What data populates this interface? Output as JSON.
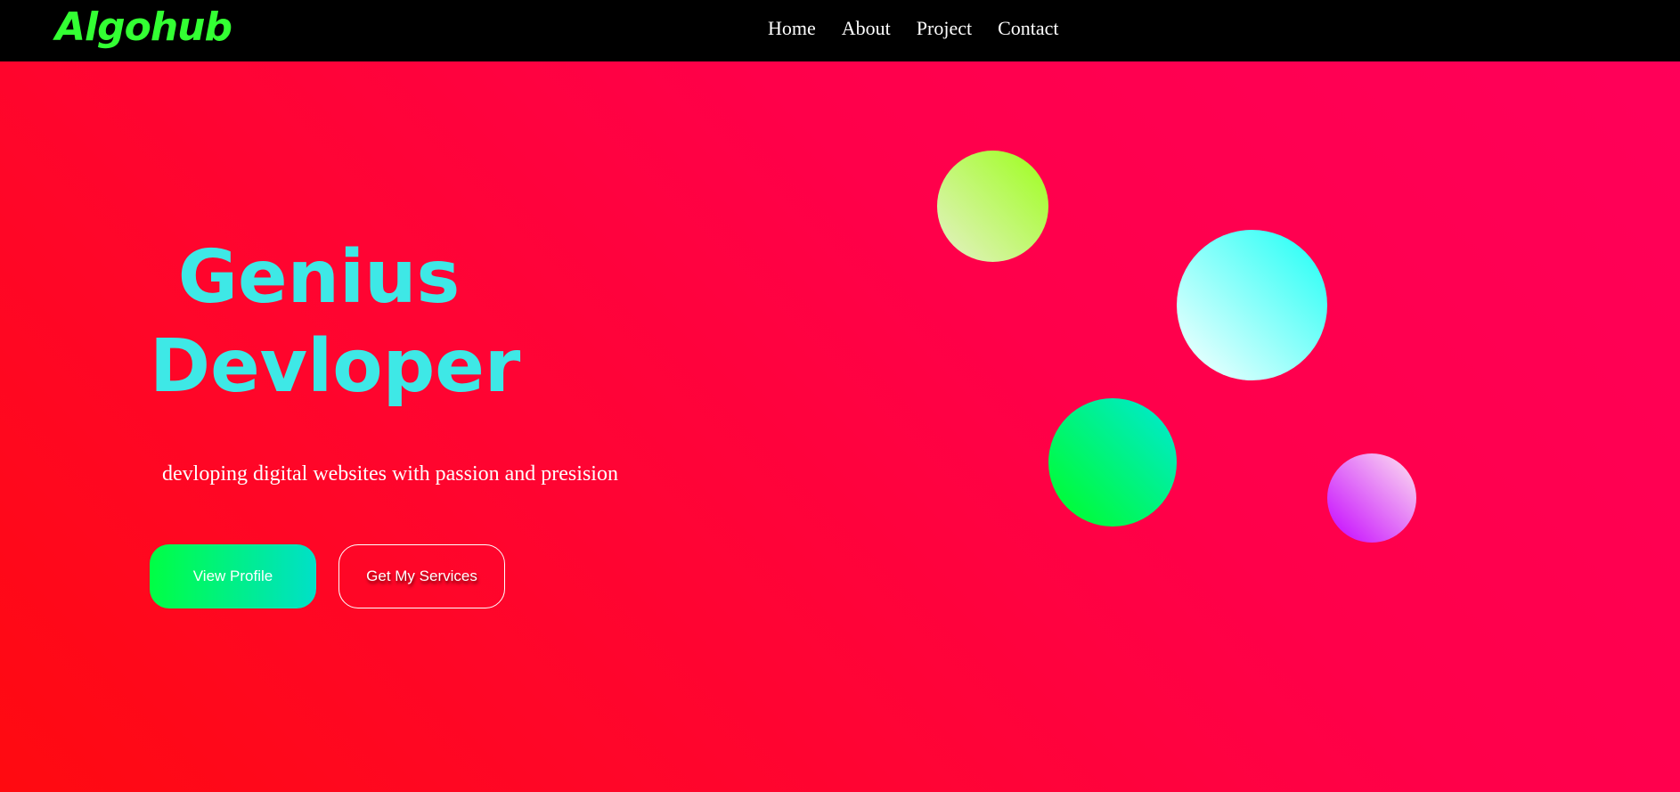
{
  "brand": {
    "logo_text": "Algohub",
    "logo_color": "#33ff33"
  },
  "nav": {
    "links": [
      {
        "label": "Home"
      },
      {
        "label": "About"
      },
      {
        "label": "Project"
      },
      {
        "label": "Contact"
      }
    ]
  },
  "hero": {
    "title_line_1": "Genius",
    "title_line_2": "Devloper",
    "subtitle": "devloping digital websites with passion and presision",
    "title_color": "#3ee8e6",
    "primary_button_label": "View Profile",
    "secondary_button_label": "Get My Services"
  },
  "colors": {
    "background_start": "#ff0a10",
    "background_end": "#ff005a",
    "navbar": "#000000"
  }
}
